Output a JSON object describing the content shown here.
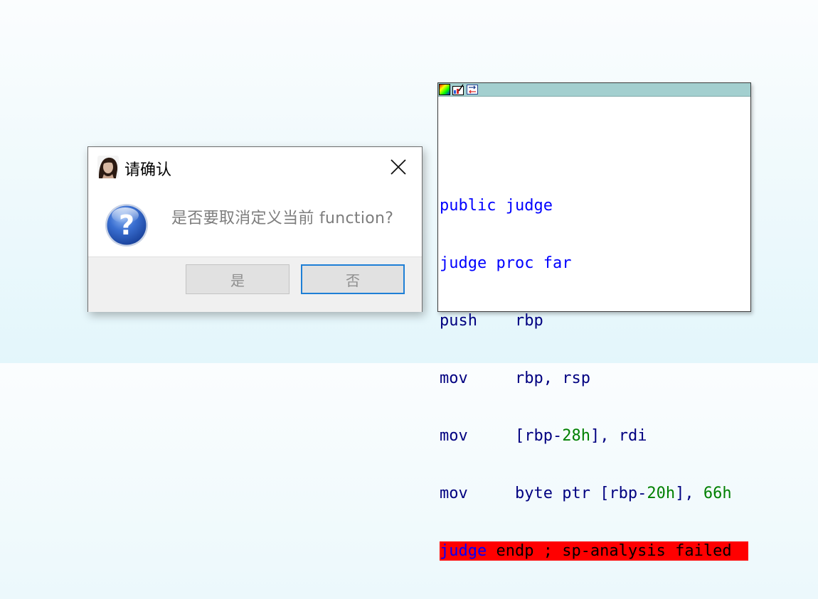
{
  "dialog": {
    "title": "请确认",
    "message": "是否要取消定义当前 function?",
    "yes_label": "是",
    "no_label": "否",
    "icons": {
      "app": "avatar-portrait-icon",
      "question": "question-mark-icon",
      "close": "close-icon"
    }
  },
  "disasm": {
    "toolbar_icons": [
      "palette-icon",
      "graph-icon",
      "sync-icon"
    ],
    "lines": {
      "l1": {
        "a": "public",
        "b": " judge"
      },
      "l2": {
        "a": "judge",
        "b": " proc far"
      },
      "l3": {
        "op": "push",
        "gap": "    ",
        "arg": "rbp"
      },
      "l4": {
        "op": "mov",
        "gap": "     ",
        "arg": "rbp, rsp"
      },
      "l5": {
        "op": "mov",
        "gap": "     ",
        "pre": "[rbp-",
        "num": "28h",
        "post": "], rdi"
      },
      "l6": {
        "op": "mov",
        "gap": "     ",
        "pre": "byte ptr [rbp-",
        "num": "20h",
        "post": "], ",
        "num2": "66h"
      },
      "l7": {
        "ident": "judge",
        "rest": " endp ; sp-analysis failed"
      }
    },
    "colors": {
      "keyword": "#0000ff",
      "operand": "#000080",
      "number": "#008000",
      "error_bg": "#ff0000",
      "toolbar_bg": "#a3cfcf"
    }
  }
}
